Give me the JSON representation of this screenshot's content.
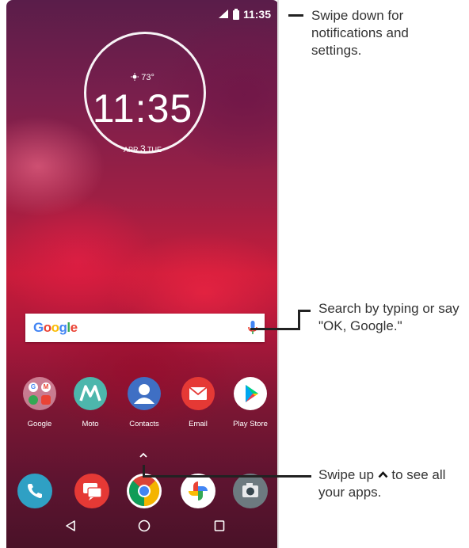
{
  "status_bar": {
    "time": "11:35"
  },
  "clock_widget": {
    "temperature": "73°",
    "time": "11:35",
    "date_month": "APR",
    "date_day": "3",
    "date_weekday": "TUE"
  },
  "search": {
    "logo": "Google"
  },
  "apps": [
    {
      "label": "Google",
      "icon": "google-folder-icon"
    },
    {
      "label": "Moto",
      "icon": "moto-icon"
    },
    {
      "label": "Contacts",
      "icon": "contacts-icon"
    },
    {
      "label": "Email",
      "icon": "email-icon"
    },
    {
      "label": "Play Store",
      "icon": "play-store-icon"
    }
  ],
  "dock": [
    {
      "icon": "phone-icon"
    },
    {
      "icon": "messages-icon"
    },
    {
      "icon": "chrome-icon"
    },
    {
      "icon": "photos-icon"
    },
    {
      "icon": "camera-icon"
    }
  ],
  "annotations": {
    "notifications": "Swipe down for notifications and settings.",
    "search": "Search by typing or say \"OK, Google.\"",
    "apps": "Swipe up ^ to see all your apps."
  },
  "colors": {
    "wallpaper_top": "#5a1d4a",
    "wallpaper_mid": "#c81c3a",
    "google_blue": "#4285F4"
  }
}
